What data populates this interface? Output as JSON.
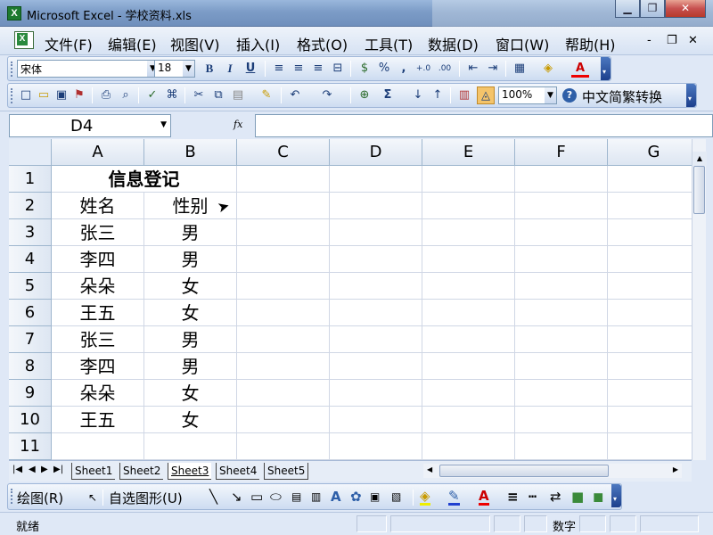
{
  "window": {
    "title": "Microsoft Excel - 学校资料.xls",
    "minimize": "▁",
    "restore": "❐",
    "close": "✕"
  },
  "menu": {
    "items": [
      "文件(F)",
      "编辑(E)",
      "视图(V)",
      "插入(I)",
      "格式(O)",
      "工具(T)",
      "数据(D)",
      "窗口(W)",
      "帮助(H)"
    ],
    "doc_min": "-",
    "doc_restore": "❐",
    "doc_close": "✕"
  },
  "format_toolbar": {
    "font": "宋体",
    "size": "18",
    "bold": "B",
    "italic": "I",
    "underline": "U",
    "align_left": "≡",
    "align_center": "≡",
    "align_right": "≡",
    "merge_center": "⊟",
    "currency": "$",
    "percent": "%",
    "comma": ",",
    "inc_decimal": "+.0",
    "dec_decimal": ".00",
    "dec_indent": "⇤",
    "inc_indent": "⇥",
    "borders": "▦",
    "fill_color": "◈",
    "font_color": "A"
  },
  "standard_toolbar": {
    "new": "□",
    "open": "▭",
    "save": "▣",
    "permission": "⚑",
    "print": "⎙",
    "preview": "⌕",
    "spelling": "✓",
    "research": "⌘",
    "cut": "✂",
    "copy": "⧉",
    "paste": "▤",
    "format_painter": "✎",
    "undo": "↶",
    "redo": "↷",
    "hyperlink": "⊕",
    "autosum": "Σ",
    "sort_asc": "↓",
    "sort_desc": "↑",
    "chart_wizard": "▥",
    "drawing": "◬",
    "zoom": "100%",
    "help": "?",
    "convert": "中文简繁转换"
  },
  "formula_bar": {
    "name_box": "D4",
    "fx": "fx",
    "content": ""
  },
  "columns": [
    "A",
    "B",
    "C",
    "D",
    "E",
    "F",
    "G"
  ],
  "rows": [
    "1",
    "2",
    "3",
    "4",
    "5",
    "6",
    "7",
    "8",
    "9",
    "10",
    "11"
  ],
  "cells": {
    "title": "信息登记",
    "header": [
      "姓名",
      "性别"
    ],
    "data": [
      [
        "张三",
        "男"
      ],
      [
        "李四",
        "男"
      ],
      [
        "朵朵",
        "女"
      ],
      [
        "王五",
        "女"
      ],
      [
        "张三",
        "男"
      ],
      [
        "李四",
        "男"
      ],
      [
        "朵朵",
        "女"
      ],
      [
        "王五",
        "女"
      ]
    ]
  },
  "sheets": [
    "Sheet1",
    "Sheet2",
    "Sheet3",
    "Sheet4",
    "Sheet5"
  ],
  "active_sheet": "Sheet3",
  "drawing_toolbar": {
    "draw": "绘图(R)",
    "autoshapes": "自选图形(U)"
  },
  "status": {
    "ready": "就绪",
    "mode": "数字"
  }
}
